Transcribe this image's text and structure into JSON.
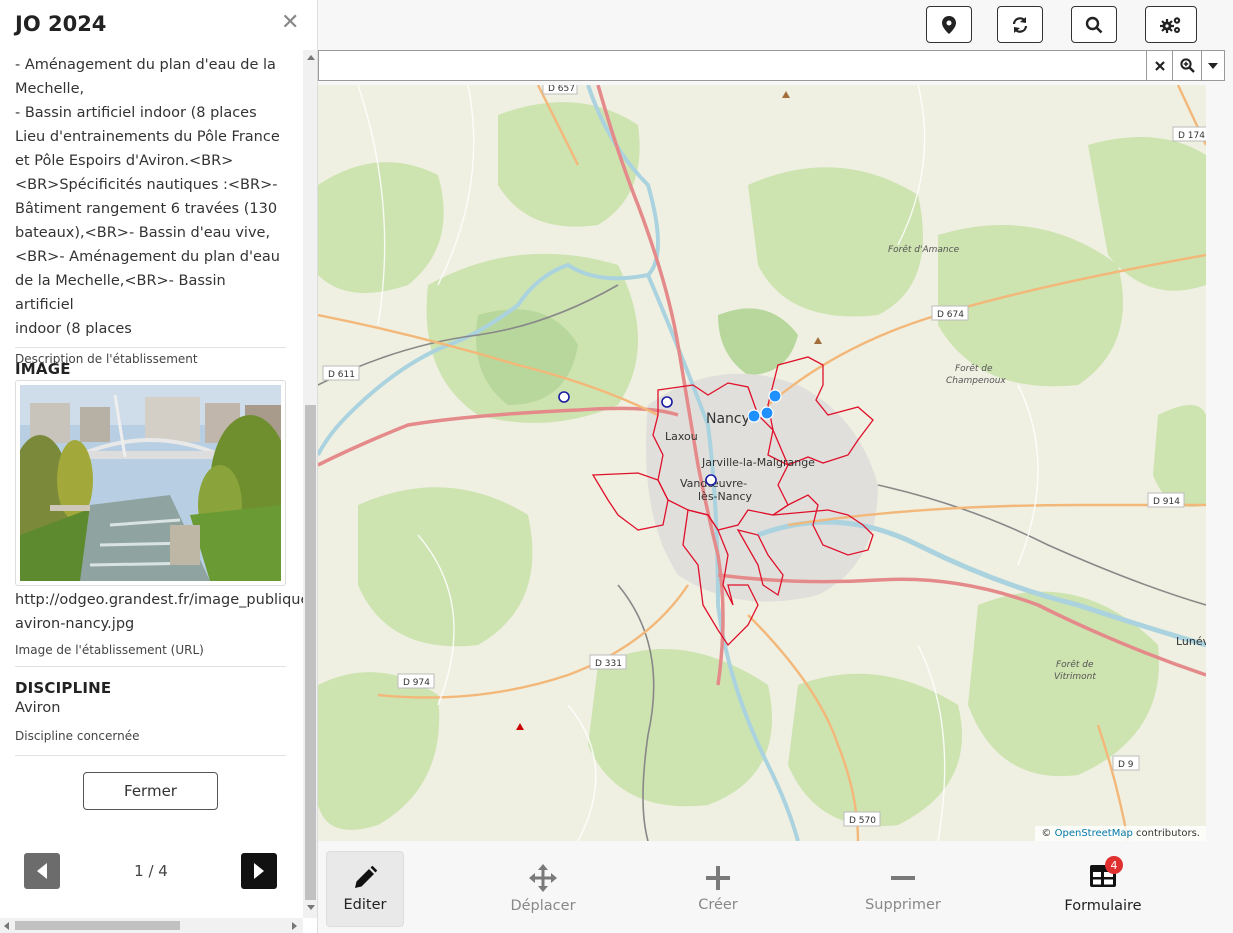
{
  "panel": {
    "title": "JO 2024",
    "description_lines": [
      "- Aménagement du plan d'eau de la",
      "Mechelle,",
      "- Bassin artificiel indoor (8 places",
      "Lieu d'entrainements du Pôle France",
      "et Pôle Espoirs d'Aviron.<BR>",
      "<BR>Spécificités nautiques :<BR>-",
      "Bâtiment rangement 6 travées (130",
      "bateaux),<BR>- Bassin d'eau vive,",
      "<BR>- Aménagement du plan d'eau",
      "de la Mechelle,<BR>- Bassin artificiel",
      "indoor (8 places"
    ],
    "description_caption": "Description de l'établissement",
    "image_section_title": "IMAGE",
    "image_url_line1": "http://odgeo.grandest.fr/image_publique",
    "image_url_line2": "aviron-nancy.jpg",
    "image_caption": "Image de l'établissement (URL)",
    "discipline_section_title": "DISCIPLINE",
    "discipline_value": "Aviron",
    "discipline_caption": "Discipline concernée",
    "close_button": "Fermer",
    "pager_text": "1 / 4"
  },
  "toolbar": {
    "icons": [
      "map-marker-icon",
      "refresh-icon",
      "search-icon",
      "settings-icon"
    ]
  },
  "search": {
    "value": "",
    "placeholder": ""
  },
  "map": {
    "attribution_prefix": "©",
    "attribution_link": "OpenStreetMap",
    "attribution_suffix": "contributors.",
    "city_label": "Nancy",
    "place_labels": [
      "Laxou",
      "Jarville-la-Malgrange",
      "Vandœuvre-",
      "lès-Nancy",
      "Lunéville",
      "Forêt d'Amance",
      "Forêt de",
      "Champenoux",
      "Forêt de",
      "Vitrimont"
    ],
    "road_labels": [
      "D 657",
      "D 174",
      "D 674",
      "D 611",
      "D 914",
      "D 331",
      "D 974",
      "D 9",
      "D 570"
    ],
    "colors": {
      "commune_border": "#e0102a",
      "marker_filled": "#1e90ff",
      "marker_hollow": "#1a1aa0"
    }
  },
  "bottom_bar": {
    "edit": "Editer",
    "move": "Déplacer",
    "create": "Créer",
    "delete": "Supprimer",
    "form": "Formulaire",
    "form_badge": "4"
  }
}
